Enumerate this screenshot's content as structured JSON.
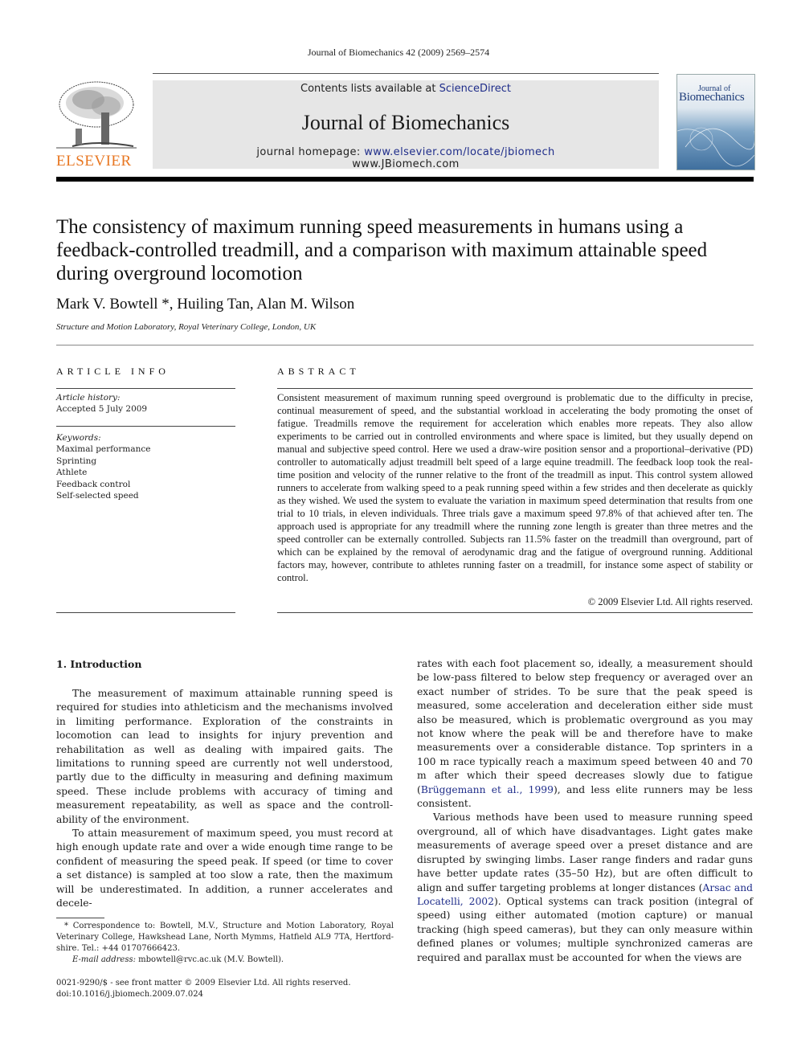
{
  "running_head": "Journal of Biomechanics 42 (2009) 2569–2574",
  "masthead": {
    "publisher_logo": "ELSEVIER",
    "contents_prefix": "Contents lists available at ",
    "contents_link": "ScienceDirect",
    "journal_title": "Journal of Biomechanics",
    "homepage_prefix": "journal homepage: ",
    "homepage_link": "www.elsevier.com/locate/jbiomech",
    "homepage_alt": "www.JBiomech.com",
    "cover_title_small": "Journal of",
    "cover_title_large": "Biomechanics",
    "brand_orange": "#e87722",
    "link_color": "#1f2d8a"
  },
  "article": {
    "title": "The consistency of maximum running speed measurements in humans using a feedback-controlled treadmill, and a comparison with maximum attainable speed during overground locomotion",
    "authors": "Mark V. Bowtell *, Huiling Tan, Alan M. Wilson",
    "affiliation": "Structure and Motion Laboratory, Royal Veterinary College, London, UK"
  },
  "article_info": {
    "heading": "ARTICLE INFO",
    "history_label": "Article history:",
    "history_value": "Accepted 5 July 2009",
    "keywords_label": "Keywords:",
    "keywords": [
      "Maximal performance",
      "Sprinting",
      "Athlete",
      "Feedback control",
      "Self-selected speed"
    ]
  },
  "abstract": {
    "heading": "ABSTRACT",
    "text": "Consistent measurement of maximum running speed overground is problematic due to the difficulty in precise, continual measurement of speed, and the substantial workload in accelerating the body promoting the onset of fatigue. Treadmills remove the requirement for acceleration which enables more repeats. They also allow experiments to be carried out in controlled environments and where space is limited, but they usually depend on manual and subjective speed control. Here we used a draw-wire position sensor and a proportional–derivative (PD) controller to automatically adjust treadmill belt speed of a large equine treadmill. The feedback loop took the real-time position and velocity of the runner relative to the front of the treadmill as input. This control system allowed runners to accelerate from walking speed to a peak running speed within a few strides and then decelerate as quickly as they wished. We used the system to evaluate the variation in maximum speed determination that results from one trial to 10 trials, in eleven individuals. Three trials gave a maximum speed 97.8% of that achieved after ten. The approach used is appropriate for any treadmill where the running zone length is greater than three metres and the speed controller can be externally controlled. Subjects ran 11.5% faster on the treadmill than overground, part of which can be explained by the removal of aerodynamic drag and the fatigue of overground running. Additional factors may, however, contribute to athletes running faster on a treadmill, for instance some aspect of stability or control.",
    "copyright": "© 2009 Elsevier Ltd. All rights reserved."
  },
  "introduction": {
    "heading": "1.  Introduction",
    "left_paragraphs": [
      "The measurement of maximum attainable running speed is required for studies into athleticism and the mechanisms involved in limiting performance. Exploration of the constraints in locomotion can lead to insights for injury prevention and rehabilitation as well as dealing with impaired gaits. The limitations to running speed are currently not well understood, partly due to the difficulty in measuring and defining maximum speed. These include problems with accuracy of timing and measurement repeatability, as well as space and the controll-ability of the environment.",
      "To attain measurement of maximum speed, you must record at high enough update rate and over a wide enough time range to be confident of measuring the speed peak. If speed (or time to cover a set distance) is sampled at too slow a rate, then the maximum will be underestimated. In addition, a runner accelerates and decele-"
    ],
    "right_p1_a": "rates with each foot placement so, ideally, a measurement should be low-pass filtered to below step frequency or averaged over an exact number of strides. To be sure that the peak speed is measured, some acceleration and deceleration either side must also be measured, which is problematic overground as you may not know where the peak will be and therefore have to make measurements over a considerable distance. Top sprinters in a 100 m race typically reach a maximum speed between 40 and 70 m after which their speed decreases slowly due to fatigue (",
    "right_p1_cite": "Brüggemann et al., 1999",
    "right_p1_b": "), and less elite runners may be less consistent.",
    "right_p2_a": "Various methods have been used to measure running speed overground, all of which have disadvantages. Light gates make measurements of average speed over a preset distance and are disrupted by swinging limbs. Laser range finders and radar guns have better update rates (35–50 Hz), but are often difficult to align and suffer targeting problems at longer distances (",
    "right_p2_cite": "Arsac and Locatelli, 2002",
    "right_p2_b": "). Optical systems can track position (integral of speed) using either automated (motion capture) or manual tracking (high speed cameras), but they can only measure within defined planes or volumes; multiple synchronized cameras are required and parallax must be accounted for when the views are"
  },
  "footnotes": {
    "correspondence": "* Correspondence to: Bowtell, M.V., Structure and Motion Laboratory, Royal Veterinary College, Hawkshead Lane, North Mymms, Hatfield AL9 7TA, Hertford-shire. Tel.: +44 01707666423.",
    "email_label": "E-mail address:",
    "email_value": " mbowtell@rvc.ac.uk (M.V. Bowtell).",
    "front_matter": "0021-9290/$ - see front matter © 2009 Elsevier Ltd. All rights reserved.",
    "doi": "doi:10.1016/j.jbiomech.2009.07.024"
  }
}
